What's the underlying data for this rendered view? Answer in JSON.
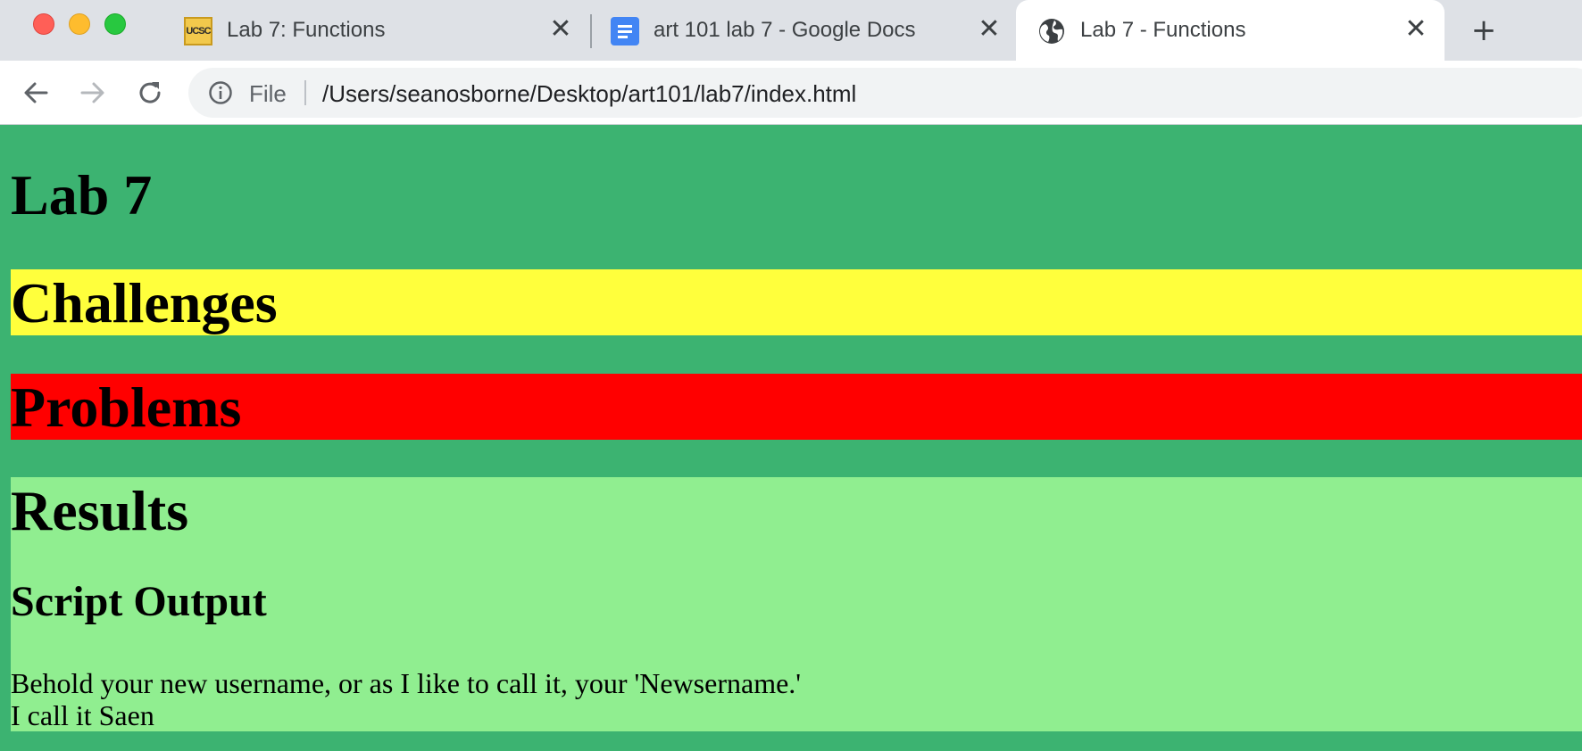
{
  "browser": {
    "tabs": [
      {
        "title": "Lab 7: Functions",
        "favicon": "ucsc-favicon",
        "favicon_text": "UCSC",
        "active": false
      },
      {
        "title": "art 101 lab 7 - Google Docs",
        "favicon": "google-docs-icon",
        "active": false
      },
      {
        "title": "Lab 7 - Functions",
        "favicon": "globe-icon",
        "active": true
      }
    ],
    "new_tab": "+",
    "close_symbol": "✕",
    "address": {
      "scheme_label": "File",
      "url": "/Users/seanosborne/Desktop/art101/lab7/index.html"
    }
  },
  "page": {
    "title": "Lab 7",
    "sections": {
      "challenges": {
        "heading": "Challenges",
        "color": "#ffff3c"
      },
      "problems": {
        "heading": "Problems",
        "color": "#ff0000"
      },
      "results": {
        "heading": "Results",
        "color": "#90ee90",
        "subheading": "Script Output",
        "output_lines": [
          "Behold your new username, or as I like to call it, your 'Newsername.'",
          "I call it Saen"
        ]
      }
    },
    "background_color": "#3cb371"
  }
}
